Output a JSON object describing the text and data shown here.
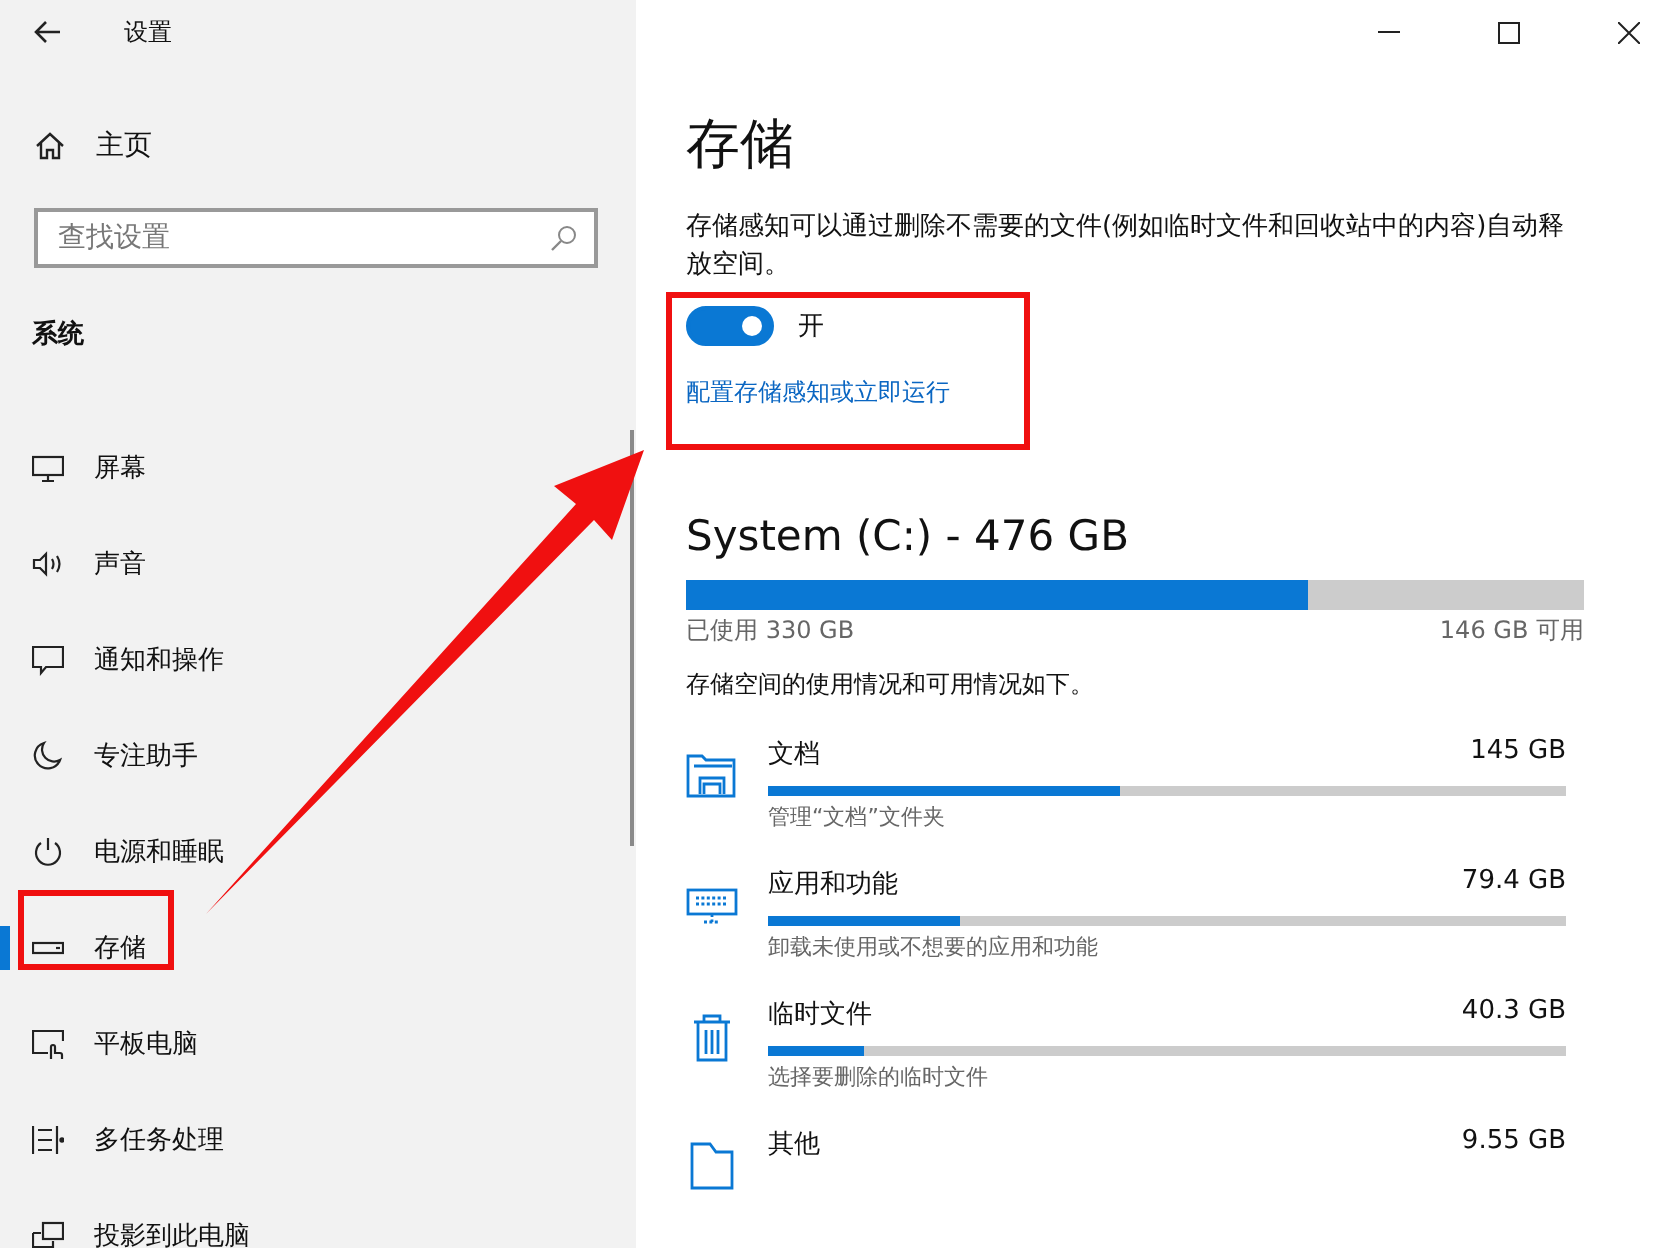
{
  "window": {
    "title": "设置"
  },
  "sidebar": {
    "home": "主页",
    "search": {
      "placeholder": "查找设置"
    },
    "section": "系统",
    "items": [
      {
        "label": "屏幕",
        "kind": "monitor",
        "selected": false
      },
      {
        "label": "声音",
        "kind": "speaker",
        "selected": false
      },
      {
        "label": "通知和操作",
        "kind": "message",
        "selected": false
      },
      {
        "label": "专注助手",
        "kind": "moon",
        "selected": false
      },
      {
        "label": "电源和睡眠",
        "kind": "power",
        "selected": false
      },
      {
        "label": "存储",
        "kind": "drive",
        "selected": true
      },
      {
        "label": "平板电脑",
        "kind": "tablet",
        "selected": false
      },
      {
        "label": "多任务处理",
        "kind": "multitask",
        "selected": false
      },
      {
        "label": "投影到此电脑",
        "kind": "project",
        "selected": false
      }
    ]
  },
  "main": {
    "title": "存储",
    "description": "存储感知可以通过删除不需要的文件(例如临时文件和回收站中的内容)自动释放空间。",
    "toggle": {
      "on": true,
      "label": "开"
    },
    "link": "配置存储感知或立即运行",
    "drive": {
      "name": "System (C:) - 476 GB",
      "level": 0.693,
      "used": "已使用 330 GB",
      "free": "146 GB 可用"
    },
    "summary": "存储空间的使用情况和可用情况如下。",
    "categories": [
      {
        "kind": "folder",
        "name": "文档",
        "size": "145 GB",
        "level": 0.44,
        "caption": "管理“文档”文件夹"
      },
      {
        "kind": "apps",
        "name": "应用和功能",
        "size": "79.4 GB",
        "level": 0.24,
        "caption": "卸载未使用或不想要的应用和功能"
      },
      {
        "kind": "trash",
        "name": "临时文件",
        "size": "40.3 GB",
        "level": 0.12,
        "caption": "选择要删除的临时文件"
      },
      {
        "kind": "other",
        "name": "其他",
        "size": "9.55 GB"
      }
    ]
  }
}
